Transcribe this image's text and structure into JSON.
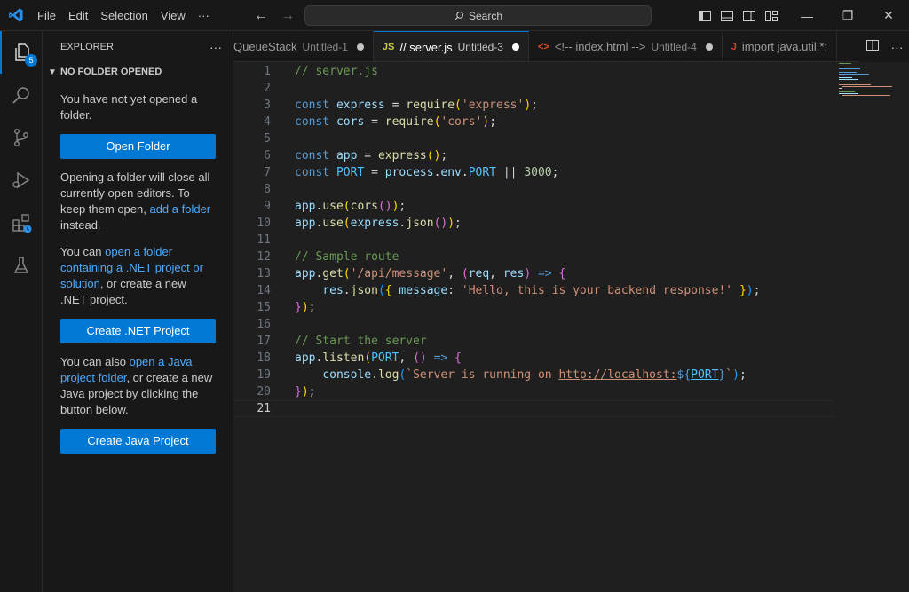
{
  "titlebar": {
    "menu": [
      "File",
      "Edit",
      "Selection",
      "View",
      "···"
    ],
    "search_label": "Search"
  },
  "activity": {
    "explorer_badge": "5"
  },
  "sidebar": {
    "title": "EXPLORER",
    "more": "···",
    "section": "NO FOLDER OPENED",
    "msg1": "You have not yet opened a folder.",
    "open_folder_btn": "Open Folder",
    "msg2_a": "Opening a folder will close all currently open editors. To keep them open, ",
    "msg2_link": "add a folder",
    "msg2_b": " instead.",
    "msg3_a": "You can ",
    "msg3_link": "open a folder containing a .NET project or solution",
    "msg3_b": ", or create a new .NET project.",
    "create_net_btn": "Create .NET Project",
    "msg4_a": "You can also ",
    "msg4_link": "open a Java project folder",
    "msg4_b": ", or create a new Java project by clicking the button below.",
    "create_java_btn": "Create Java Project"
  },
  "tabs": [
    {
      "name": "QueueStack",
      "desc": "Untitled-1",
      "icon": ""
    },
    {
      "name": "// server.js",
      "desc": "Untitled-3",
      "icon": "JS"
    },
    {
      "name": "<!-- index.html -->",
      "desc": "Untitled-4",
      "icon": "<>"
    },
    {
      "name": "import java.util.*;",
      "desc": "",
      "icon": "J"
    }
  ],
  "editor": {
    "line_numbers": [
      "1",
      "2",
      "3",
      "4",
      "5",
      "6",
      "7",
      "8",
      "9",
      "10",
      "11",
      "12",
      "13",
      "14",
      "15",
      "16",
      "17",
      "18",
      "19",
      "20",
      "21"
    ],
    "lines": [
      "// server.js",
      "",
      "const express = require('express');",
      "const cors = require('cors');",
      "",
      "const app = express();",
      "const PORT = process.env.PORT || 3000;",
      "",
      "app.use(cors());",
      "app.use(express.json());",
      "",
      "// Sample route",
      "app.get('/api/message', (req, res) => {",
      "    res.json({ message: 'Hello, this is your backend response!' });",
      "});",
      "",
      "// Start the server",
      "app.listen(PORT, () => {",
      "    console.log(`Server is running on http://localhost:${PORT}`);",
      "});",
      ""
    ]
  },
  "colors": {
    "accent": "#0078d4",
    "keyword": "#569cd6",
    "variable": "#9cdcfe",
    "function": "#dcdcaa",
    "string": "#ce9178",
    "comment": "#6a9955",
    "number": "#b5cea8"
  }
}
